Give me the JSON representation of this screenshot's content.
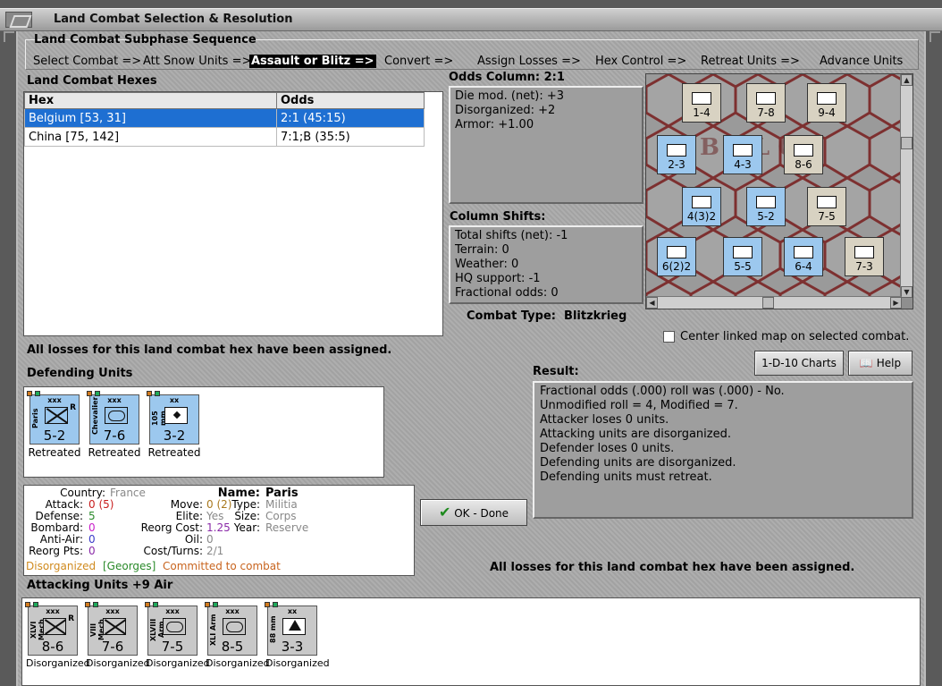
{
  "window": {
    "title": "Land Combat Selection & Resolution"
  },
  "sequence": {
    "title": "Land Combat Subphase Sequence",
    "steps": [
      "Select Combat =>",
      "Att Snow Units =>",
      "Assault or Blitz =>",
      "Convert =>",
      "Assign Losses =>",
      "Hex Control =>",
      "Retreat Units =>",
      "Advance Units"
    ],
    "active_index": 2
  },
  "hexes": {
    "label": "Land Combat Hexes",
    "headers": [
      "Hex",
      "Odds"
    ],
    "rows": [
      {
        "hex": "Belgium [53, 31]",
        "odds": "2:1 (45:15)"
      },
      {
        "hex": "China [75, 142]",
        "odds": "7:1;B (35:5)"
      }
    ]
  },
  "odds_column": {
    "label": "Odds Column: 2:1",
    "lines": [
      "Die mod. (net): +3",
      "Disorganized: +2",
      "Armor: +1.00"
    ]
  },
  "column_shifts": {
    "label": "Column Shifts:",
    "lines": [
      "Total shifts (net): -1",
      "Terrain: 0",
      "Weather: 0",
      "HQ support: -1",
      "Fractional odds: 0"
    ]
  },
  "combat_type": {
    "label": "Combat Type:",
    "value": "Blitzkrieg"
  },
  "center_map": {
    "label": "Center linked map on selected combat.",
    "checked": false
  },
  "buttons": {
    "charts": "1-D-10 Charts",
    "help": "Help",
    "ok": "OK - Done"
  },
  "losses_msg": "All losses for this land combat hex have been assigned.",
  "defending": {
    "label": "Defending Units",
    "units": [
      {
        "size": "xxx",
        "name": "Paris",
        "strength": "5-2",
        "status": "Retreated",
        "r": "R",
        "type": "mil"
      },
      {
        "size": "xxx",
        "name": "Chevalier",
        "strength": "7-6",
        "status": "Retreated",
        "r": "",
        "type": "arm"
      },
      {
        "size": "xx",
        "name": "105 mm",
        "strength": "3-2",
        "status": "Retreated",
        "r": "",
        "type": "art"
      }
    ]
  },
  "result": {
    "label": "Result:",
    "lines": [
      "Fractional odds (.000) roll was (.000)  - No.",
      "Unmodified roll = 4, Modified = 7.",
      "Attacker loses 0 units.",
      "Attacking units are disorganized.",
      "Defender loses 0 units.",
      "Defending units are disorganized.",
      "Defending units must retreat."
    ]
  },
  "unit_info": {
    "country_k": "Country:",
    "country_v": "France",
    "attack_k": "Attack:",
    "attack_v": "0",
    "attack_v2": "(5)",
    "defense_k": "Defense:",
    "defense_v": "5",
    "bombard_k": "Bombard:",
    "bombard_v": "0",
    "antiair_k": "Anti-Air:",
    "antiair_v": "0",
    "reorg_k": "Reorg Pts:",
    "reorg_v": "0",
    "move_k": "Move:",
    "move_v": "0",
    "move_v2": "(2)",
    "elite_k": "Elite:",
    "elite_v": "Yes",
    "reorgcost_k": "Reorg Cost:",
    "reorgcost_v": "1.25",
    "oil_k": "Oil:",
    "oil_v": "0",
    "cost_k": "Cost/Turns:",
    "cost_v": "2/1",
    "name_k": "Name:",
    "name_v": "Paris",
    "type_k": "Type:",
    "type_v": "Militia",
    "size_k": "Size:",
    "size_v": "Corps",
    "year_k": "Year:",
    "year_v": "Reserve",
    "status_1": "Disorganized",
    "status_2": "[Georges]",
    "status_3": "Committed to combat"
  },
  "attacking": {
    "label": "Attacking Units +9 Air",
    "units": [
      {
        "size": "xxx",
        "name": "XLVI Mech",
        "strength": "8-6",
        "status": "Disorganized",
        "r": "R",
        "type": "inf"
      },
      {
        "size": "xxx",
        "name": "VIII Mech",
        "strength": "7-6",
        "status": "Disorganized",
        "r": "",
        "type": "inf"
      },
      {
        "size": "xxx",
        "name": "XLVIII Arm",
        "strength": "7-5",
        "status": "Disorganized",
        "r": "",
        "type": "arm"
      },
      {
        "size": "xxx",
        "name": "XLI Arm",
        "strength": "8-5",
        "status": "Disorganized",
        "r": "",
        "type": "arm"
      },
      {
        "size": "xx",
        "name": "88 mm",
        "strength": "3-3",
        "status": "Disorganized",
        "r": "",
        "type": "flak"
      }
    ]
  },
  "map": {
    "counters": [
      {
        "s": "1-4"
      },
      {
        "s": "7-8"
      },
      {
        "s": "9-4"
      },
      {
        "s": "2-3"
      },
      {
        "s": "4-3"
      },
      {
        "s": "8-6"
      },
      {
        "s": "4(3)2"
      },
      {
        "s": "5-2"
      },
      {
        "s": "7-5"
      },
      {
        "s": "6(2)2"
      },
      {
        "s": "5-5"
      },
      {
        "s": "6-4"
      },
      {
        "s": "7-3"
      }
    ]
  },
  "colors": {
    "selection": "#1e6fd2",
    "german": "#c8c8c8",
    "french": "#9cc8ee",
    "disorg_orange": "#d08a1e",
    "green": "#2a8a2a",
    "purple": "#8a2aa8"
  }
}
